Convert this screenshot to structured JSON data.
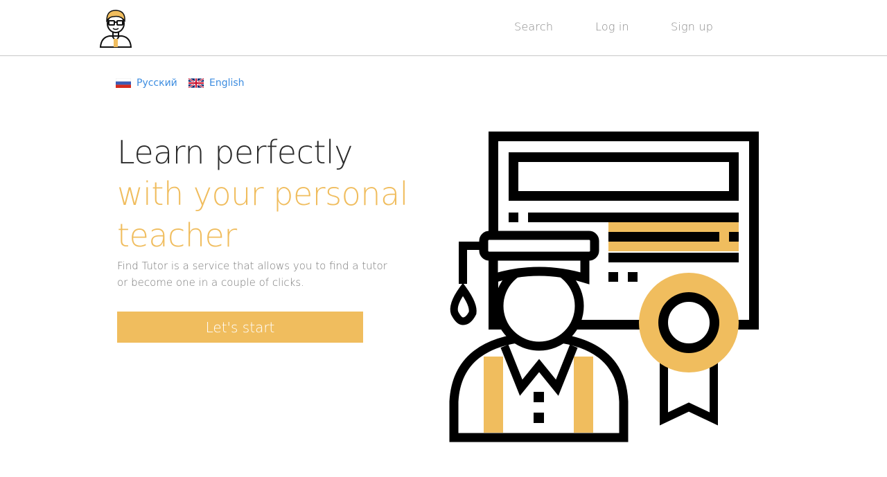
{
  "header": {
    "nav": {
      "search": "Search",
      "login": "Log in",
      "signup": "Sign up"
    }
  },
  "languages": {
    "russian": "Русский",
    "english": "English"
  },
  "hero": {
    "line1": "Learn perfectly",
    "line2": "with your personal",
    "line3": "teacher",
    "description": "Find Tutor is a service that allows you to find a tutor or become one in a couple of clicks.",
    "cta": "Let's start"
  },
  "colors": {
    "accent": "#f0bd5e",
    "link": "#3d8de0",
    "text_dark": "#2b2b2b",
    "text_muted": "#7a7a7a"
  },
  "icons": {
    "logo": "tutor-avatar-icon",
    "illustration": "graduate-certificate-icon"
  }
}
